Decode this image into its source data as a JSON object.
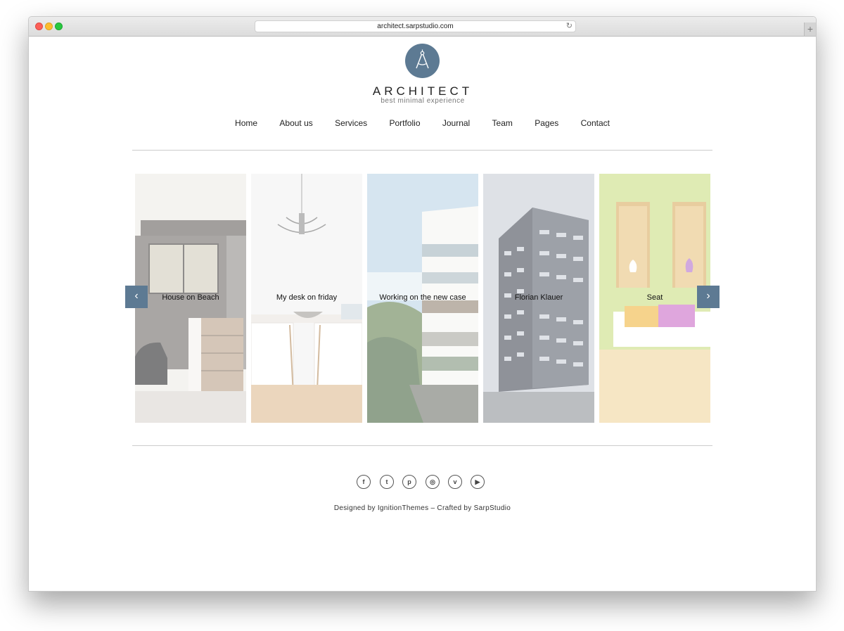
{
  "browser": {
    "url": "architect.sarpstudio.com",
    "reload_glyph": "↻",
    "new_tab_glyph": "+"
  },
  "brand": {
    "title": "ARCHITECT",
    "tagline": "best minimal experience",
    "accent_color": "#5d7a93",
    "logo_icon": "compass-icon"
  },
  "nav": {
    "items": [
      "Home",
      "About us",
      "Services",
      "Portfolio",
      "Journal",
      "Team",
      "Pages",
      "Contact"
    ]
  },
  "slider": {
    "prev_glyph": "‹",
    "next_glyph": "›",
    "slides": [
      {
        "caption": "House on Beach"
      },
      {
        "caption": "My desk on friday"
      },
      {
        "caption": "Working on the new case"
      },
      {
        "caption": "Florian Klauer"
      },
      {
        "caption": "Seat"
      }
    ]
  },
  "footer": {
    "social": [
      {
        "name": "facebook-icon",
        "glyph": "f"
      },
      {
        "name": "twitter-icon",
        "glyph": "t"
      },
      {
        "name": "pinterest-icon",
        "glyph": "p"
      },
      {
        "name": "dribbble-icon",
        "glyph": "◎"
      },
      {
        "name": "vimeo-icon",
        "glyph": "v"
      },
      {
        "name": "youtube-icon",
        "glyph": "▶"
      }
    ],
    "credits": "Designed by IgnitionThemes – Crafted by SarpStudio"
  }
}
